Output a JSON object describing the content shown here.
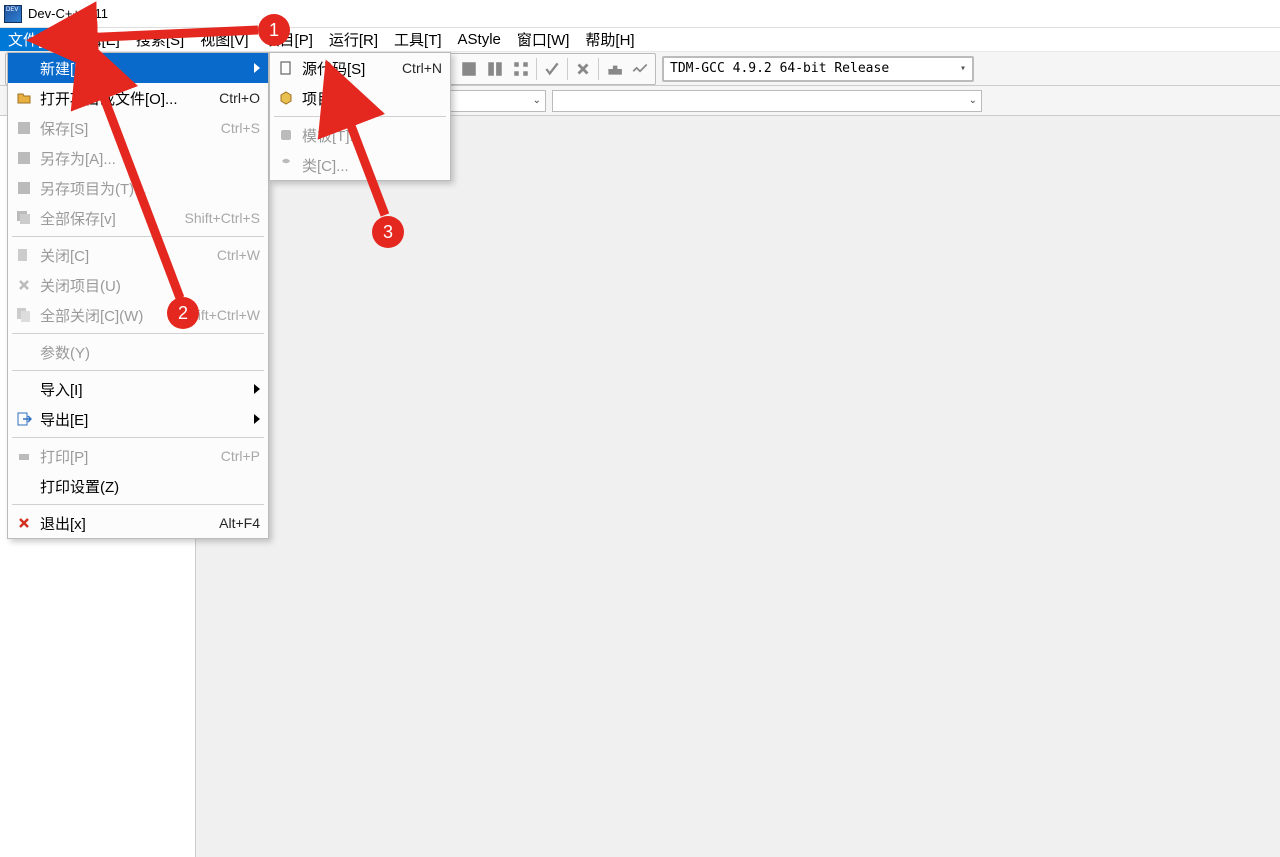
{
  "title": "Dev-C++ 5.11",
  "menubar": {
    "items": [
      "文件[F]",
      "编辑[E]",
      "搜索[S]",
      "视图[V]",
      "项目[P]",
      "运行[R]",
      "工具[T]",
      "AStyle",
      "窗口[W]",
      "帮助[H]"
    ]
  },
  "compiler_combo": "TDM-GCC 4.9.2 64-bit Release",
  "file_menu": {
    "new": {
      "label": "新建[N]"
    },
    "open": {
      "label": "打开项目或文件[O]...",
      "shortcut": "Ctrl+O"
    },
    "save": {
      "label": "保存[S]",
      "shortcut": "Ctrl+S"
    },
    "saveas": {
      "label": "另存为[A]..."
    },
    "saveprojas": {
      "label": "另存项目为(T)..."
    },
    "saveall": {
      "label": "全部保存[v]",
      "shortcut": "Shift+Ctrl+S"
    },
    "close": {
      "label": "关闭[C]",
      "shortcut": "Ctrl+W"
    },
    "closeproj": {
      "label": "关闭项目(U)"
    },
    "closeall": {
      "label": "全部关闭[C](W)",
      "shortcut": "Shift+Ctrl+W"
    },
    "params": {
      "label": "参数(Y)"
    },
    "import": {
      "label": "导入[I]"
    },
    "export": {
      "label": "导出[E]"
    },
    "print": {
      "label": "打印[P]",
      "shortcut": "Ctrl+P"
    },
    "printset": {
      "label": "打印设置(Z)"
    },
    "exit": {
      "label": "退出[x]",
      "shortcut": "Alt+F4"
    }
  },
  "new_submenu": {
    "source": {
      "label": "源代码[S]",
      "shortcut": "Ctrl+N"
    },
    "project": {
      "label": "项目[P]..."
    },
    "template": {
      "label": "模板[T]..."
    },
    "class": {
      "label": "类[C]..."
    }
  },
  "markers": {
    "m1": "1",
    "m2": "2",
    "m3": "3"
  }
}
